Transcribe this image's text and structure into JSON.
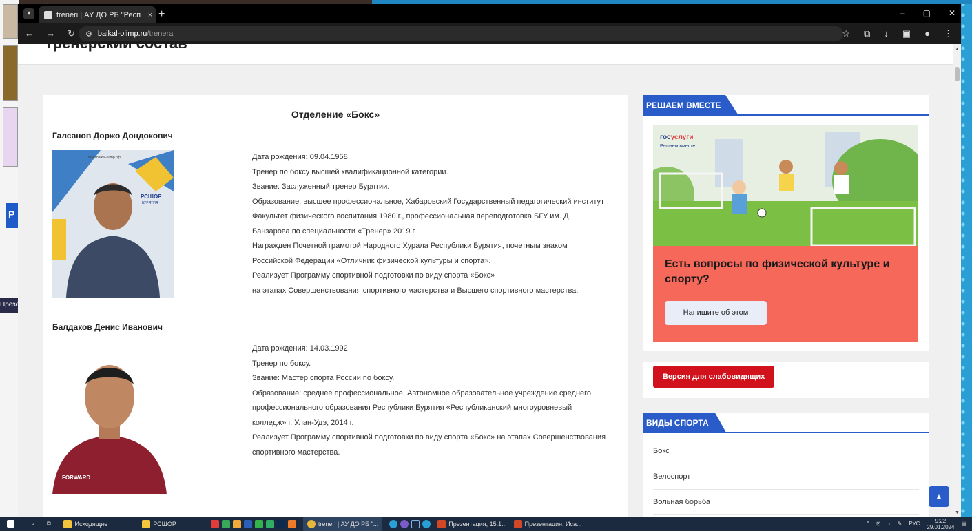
{
  "browser": {
    "tab_list_icon": "chevron-down-icon",
    "tab_title": "treneri | АУ ДО РБ \"Республикан",
    "tab_close": "×",
    "new_tab": "+",
    "url_domain": "baikal-olimp.ru",
    "url_path": "/trenera",
    "window_controls": [
      "–",
      "▢",
      "✕"
    ]
  },
  "page": {
    "heading": "Тренерский состав",
    "section_title": "Отделение «Бокс»",
    "coaches": [
      {
        "name": "Галсанов Доржо Дондокович",
        "bio": [
          "Дата рождения: 09.04.1958",
          "Тренер по боксу высшей квалификационной категории.",
          "Звание: Заслуженный тренер Бурятии.",
          "Образование: высшее профессиональное, Хабаровский Государственный педагогический институт",
          "Факультет физического воспитания 1980 г., профессиональная переподготовка БГУ им. Д.",
          "Банзарова по специальности «Тренер» 2019 г.",
          "Награжден Почетной грамотой Народного Хурала Республики Бурятия, почетным знаком",
          "Российской Федерации «Отличник физической культуры и спорта».",
          "Реализует Программу спортивной подготовки по виду спорта «Бокс»",
          "на этапах Совершенствования спортивного мастерства и Высшего спортивного мастерства."
        ]
      },
      {
        "name": "Балдаков Денис Иванович",
        "bio": [
          "Дата рождения: 14.03.1992",
          "Тренер по боксу.",
          "Звание: Мастер спорта России по боксу.",
          "Образование: среднее профессиональное, Автономное образовательное учреждение среднего",
          "профессионального образования Республики Бурятия «Республиканский многоуровневый",
          "колледж» г. Улан-Удэ, 2014 г.",
          "Реализует Программу спортивной подготовки по виду спорта «Бокс» на этапах Совершенствования",
          "спортивного мастерства."
        ]
      }
    ]
  },
  "photo_text": {
    "rshor": "РСШОР",
    "rshor_sub": "БУРЯТИЯ",
    "website": "www.baikal-olimp.рф",
    "jacket": "FORWARD"
  },
  "sidebar": {
    "decide_together": {
      "header": "РЕШАЕМ ВМЕСТЕ",
      "logo_gos": "гос",
      "logo_uslugi": "услуги",
      "logo_sub": "Решаем вместе",
      "question": "Есть вопросы по физической культуре и спорту?",
      "button": "Напишите об этом"
    },
    "vision_button": "Версия для слабовидящих",
    "sports": {
      "header": "ВИДЫ СПОРТА",
      "items": [
        "Бокс",
        "Велоспорт",
        "Вольная борьба"
      ]
    }
  },
  "taskbar": {
    "items": [
      "Исходящие",
      "РСШОР",
      "treneri | АУ ДО РБ \"...",
      "Презентация, 15.1...",
      "Презентация, Иса..."
    ],
    "lang": "РУС",
    "time": "9:22",
    "date": "29.01.2024"
  },
  "desktop": {
    "blue_tab_letter": "Р",
    "pres_label": "Презен"
  }
}
